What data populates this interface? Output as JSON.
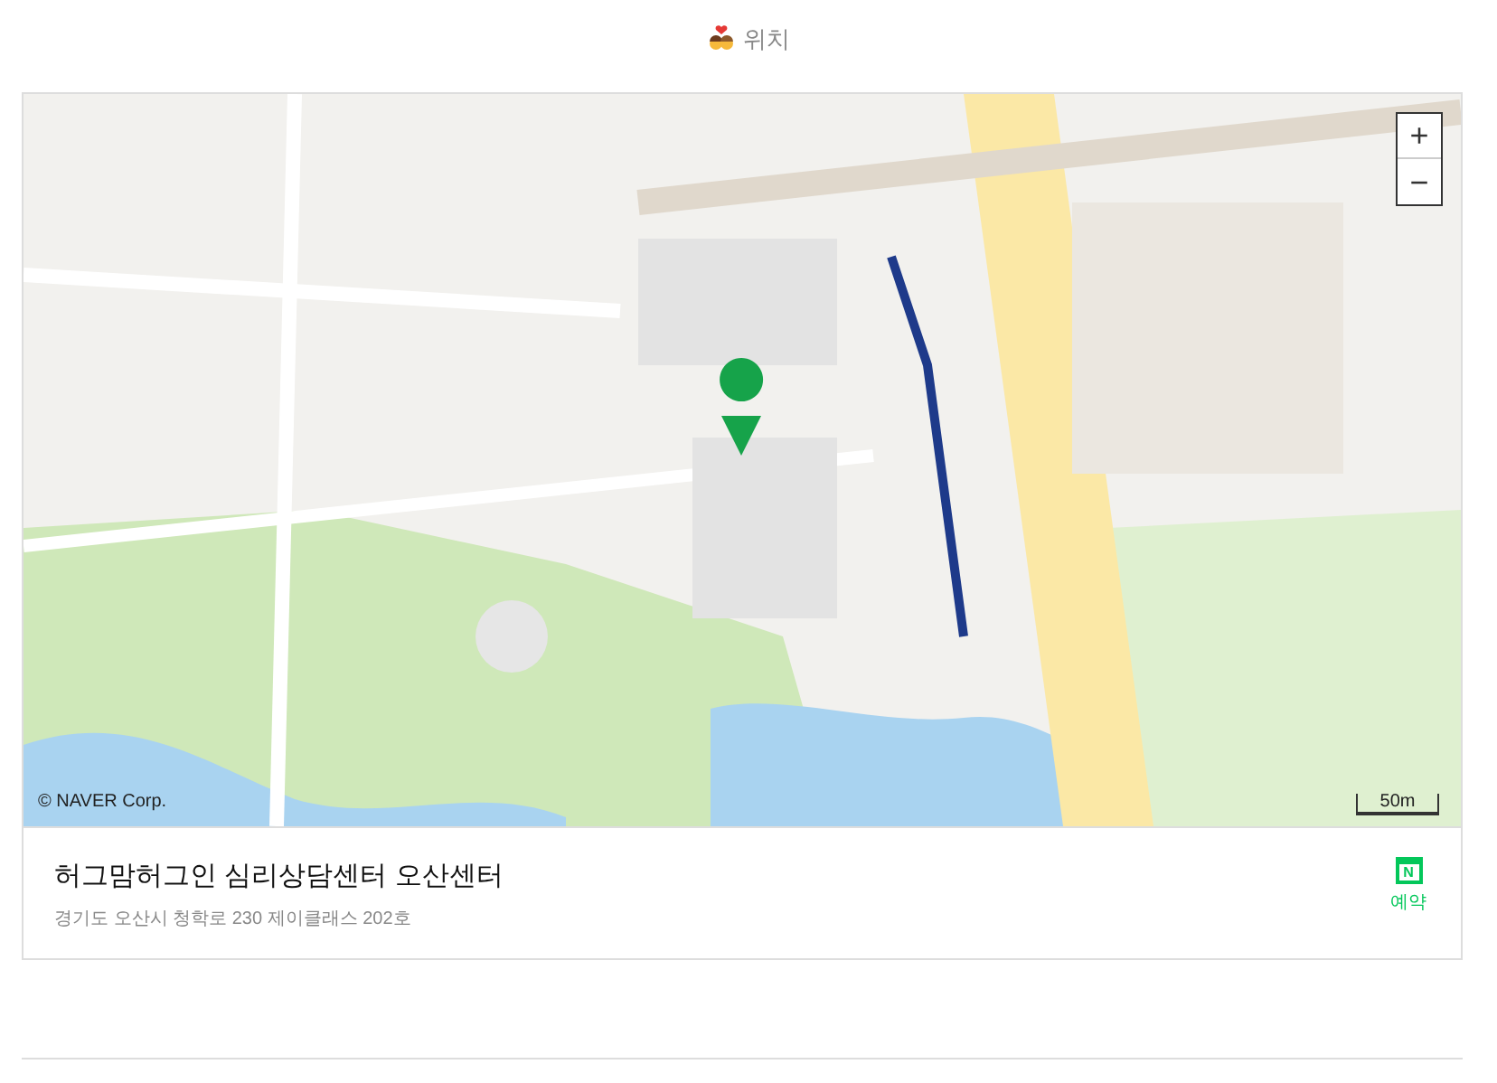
{
  "header": {
    "title": "위치"
  },
  "map": {
    "zoom_in": "+",
    "zoom_out": "−",
    "copyright": "© NAVER Corp.",
    "scale": "50m"
  },
  "place": {
    "name": "허그맘허그인 심리상담센터 오산센터",
    "address": "경기도 오산시 청학로 230 제이클래스 202호"
  },
  "booking": {
    "icon_letter": "N",
    "label": "예약"
  }
}
